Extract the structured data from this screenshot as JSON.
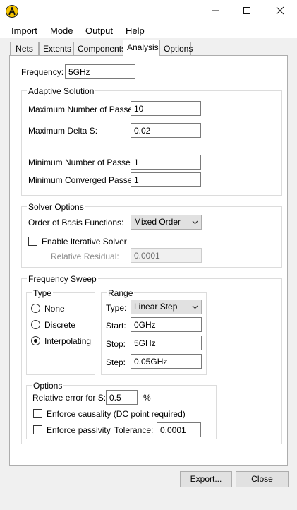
{
  "menu": {
    "items": [
      "Import",
      "Mode",
      "Output",
      "Help"
    ]
  },
  "tabs": [
    "Nets",
    "Extents",
    "Components",
    "Analysis",
    "Options"
  ],
  "active_tab": "Analysis",
  "frequency": {
    "label": "Frequency:",
    "value": "5GHz"
  },
  "adaptive": {
    "title": "Adaptive Solution",
    "max_passes_label": "Maximum Number of Passes:",
    "max_passes_value": "10",
    "max_delta_label": "Maximum Delta S:",
    "max_delta_value": "0.02",
    "min_passes_label": "Minimum Number of Passes:",
    "min_passes_value": "1",
    "min_converged_label": "Minimum Converged Passes:",
    "min_converged_value": "1"
  },
  "solver": {
    "title": "Solver Options",
    "basis_label": "Order of Basis Functions:",
    "basis_value": "Mixed Order",
    "iterative_label": "Enable Iterative Solver",
    "iterative_checked": false,
    "residual_label": "Relative Residual:",
    "residual_value": "0.0001"
  },
  "sweep": {
    "title": "Frequency Sweep",
    "type_group": {
      "title": "Type",
      "options": [
        "None",
        "Discrete",
        "Interpolating"
      ],
      "selected": "Interpolating"
    },
    "range": {
      "title": "Range",
      "type_label": "Type:",
      "type_value": "Linear Step",
      "start_label": "Start:",
      "start_value": "0GHz",
      "stop_label": "Stop:",
      "stop_value": "5GHz",
      "step_label": "Step:",
      "step_value": "0.05GHz"
    },
    "options": {
      "title": "Options",
      "rel_error_label": "Relative error for S:",
      "rel_error_value": "0.5",
      "rel_error_unit": "%",
      "causality_label": "Enforce causality (DC point required)",
      "causality_checked": false,
      "passivity_label": "Enforce passivity",
      "passivity_checked": false,
      "tolerance_label": "Tolerance:",
      "tolerance_value": "0.0001"
    }
  },
  "buttons": {
    "export": "Export...",
    "close": "Close"
  }
}
